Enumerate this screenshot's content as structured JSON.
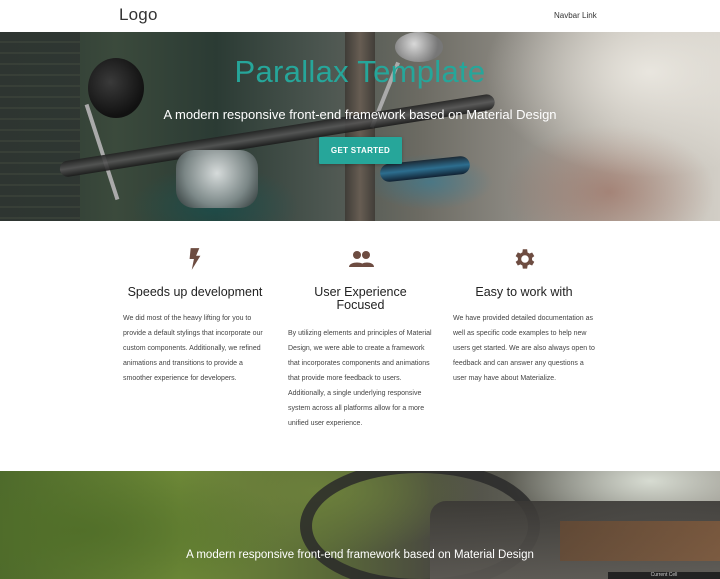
{
  "navbar": {
    "logo": "Logo",
    "link": "Navbar Link"
  },
  "hero": {
    "title": "Parallax Template",
    "subtitle": "A modern responsive front-end framework based on Material Design",
    "cta": "GET STARTED"
  },
  "features": [
    {
      "icon": "flash-icon",
      "title": "Speeds up development",
      "text": "We did most of the heavy lifting for you to provide a default stylings that incorporate our custom components. Additionally, we refined animations and transitions to provide a smoother experience for developers."
    },
    {
      "icon": "group-icon",
      "title": "User Experience Focused",
      "text": "By utilizing elements and principles of Material Design, we were able to create a framework that incorporates components and animations that provide more feedback to users. Additionally, a single underlying responsive system across all platforms allow for a more unified user experience."
    },
    {
      "icon": "settings-icon",
      "title": "Easy to work with",
      "text": "We have provided detailed documentation as well as specific code examples to help new users get started. We are also always open to feedback and can answer any questions a user may have about Materialize."
    }
  ],
  "bottom": {
    "text": "A modern responsive front-end framework based on Material Design"
  },
  "status_tab": "Current Cell",
  "colors": {
    "accent": "#26a69a",
    "icon": "#6d4c41"
  }
}
